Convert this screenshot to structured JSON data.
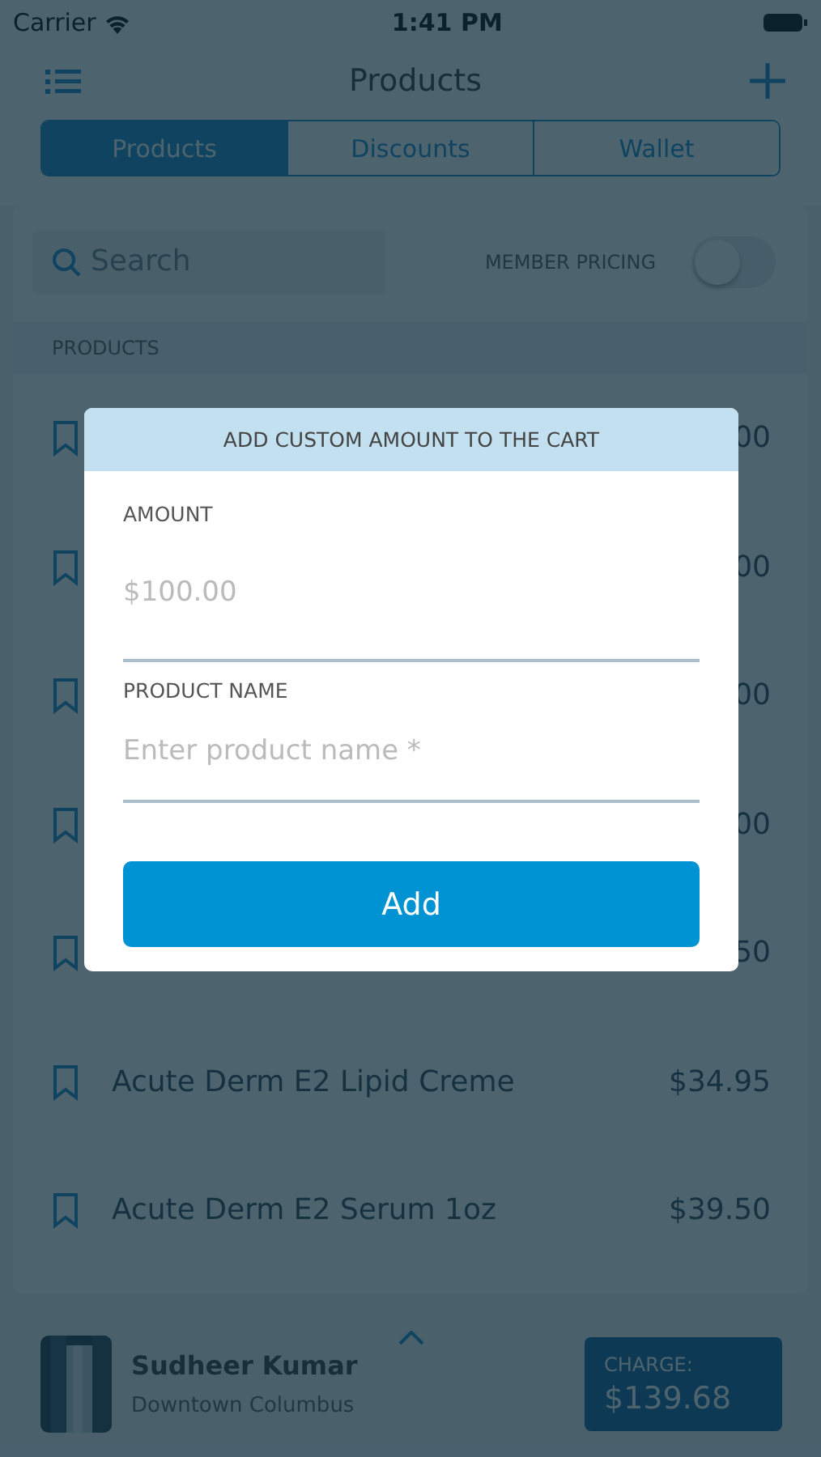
{
  "status_bar": {
    "carrier": "Carrier",
    "time": "1:41 PM"
  },
  "nav": {
    "title": "Products"
  },
  "tabs": [
    {
      "label": "Products",
      "selected": true
    },
    {
      "label": "Discounts",
      "selected": false
    },
    {
      "label": "Wallet",
      "selected": false
    }
  ],
  "search": {
    "placeholder": "Search"
  },
  "member_pricing": {
    "label": "MEMBER PRICING",
    "on": false
  },
  "products": {
    "header": "PRODUCTS",
    "rows": [
      {
        "price": "00"
      },
      {
        "price": "00"
      },
      {
        "price": "00"
      },
      {
        "price": "00"
      },
      {
        "price": "50"
      },
      {
        "name": "Acute Derm E2 Lipid Creme",
        "price": "$34.95"
      },
      {
        "name": "Acute Derm E2 Serum 1oz",
        "price": "$39.50"
      }
    ]
  },
  "customer": {
    "name": "Sudheer Kumar",
    "location": "Downtown Columbus",
    "charge_label": "CHARGE:",
    "charge": "$139.68"
  },
  "dialog": {
    "title": "ADD CUSTOM AMOUNT TO THE CART",
    "fields": [
      {
        "label": "AMOUNT",
        "placeholder": "$100.00"
      },
      {
        "label": "PRODUCT NAME",
        "placeholder": "Enter product name *"
      }
    ],
    "button": "Add"
  }
}
